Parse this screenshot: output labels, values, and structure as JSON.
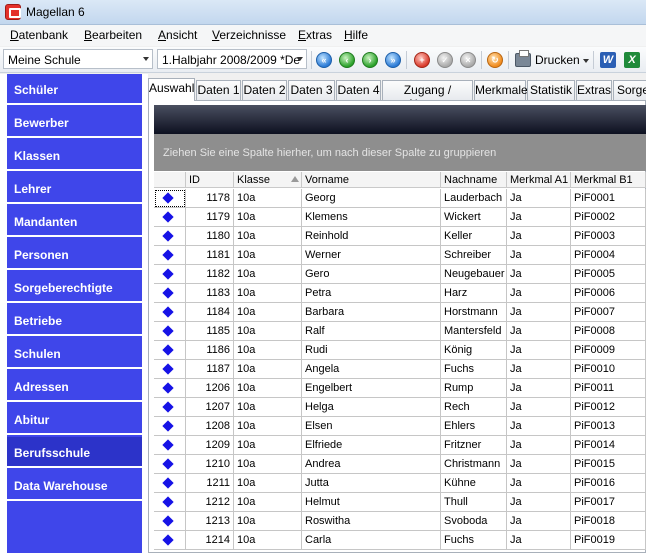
{
  "window": {
    "title": "Magellan 6"
  },
  "menu": [
    {
      "label": "Datenbank",
      "u": "D",
      "rest": "atenbank"
    },
    {
      "label": "Bearbeiten",
      "u": "B",
      "rest": "earbeiten"
    },
    {
      "label": "Ansicht",
      "u": "A",
      "rest": "nsicht"
    },
    {
      "label": "Verzeichnisse",
      "u": "V",
      "rest": "erzeichnisse"
    },
    {
      "label": "Extras",
      "u": "E",
      "rest": "xtras"
    },
    {
      "label": "Hilfe",
      "u": "H",
      "rest": "ilfe"
    }
  ],
  "toolbar": {
    "school_value": "Meine Schule",
    "period_value": "1.Halbjahr 2008/2009 *De",
    "print_label": "Drucken",
    "icons": [
      "first-icon",
      "prev-icon",
      "next-icon",
      "last-icon",
      "add-icon",
      "confirm-icon",
      "cancel-icon",
      "refresh-icon",
      "printer-icon",
      "word-icon",
      "excel-icon"
    ],
    "word_letter": "W",
    "excel_letter": "X"
  },
  "sidebar": {
    "items": [
      {
        "label": "Schüler",
        "active": false
      },
      {
        "label": "Bewerber",
        "active": false
      },
      {
        "label": "Klassen",
        "active": false
      },
      {
        "label": "Lehrer",
        "active": false
      },
      {
        "label": "Mandanten",
        "active": false
      },
      {
        "label": "Personen",
        "active": false
      },
      {
        "label": "Sorgeberechtigte",
        "active": false
      },
      {
        "label": "Betriebe",
        "active": false
      },
      {
        "label": "Schulen",
        "active": false
      },
      {
        "label": "Adressen",
        "active": false
      },
      {
        "label": "Abitur",
        "active": false
      },
      {
        "label": "Berufsschule",
        "active": true
      },
      {
        "label": "Data Warehouse",
        "active": false
      }
    ]
  },
  "tabs": [
    {
      "label": "Auswahl",
      "active": true
    },
    {
      "label": "Daten 1",
      "active": false
    },
    {
      "label": "Daten 2",
      "active": false
    },
    {
      "label": "Daten 3",
      "active": false
    },
    {
      "label": "Daten 4",
      "active": false
    },
    {
      "label": "Zugang / Abgang",
      "active": false
    },
    {
      "label": "Merkmale",
      "active": false
    },
    {
      "label": "Statistik",
      "active": false
    },
    {
      "label": "Extras",
      "active": false
    },
    {
      "label": "Sorge",
      "active": false
    }
  ],
  "grid": {
    "group_hint": "Ziehen Sie eine Spalte hierher, um nach dieser Spalte zu gruppieren",
    "columns": [
      "ID",
      "Klasse",
      "Vorname",
      "Nachname",
      "Merkmal A1",
      "Merkmal B1"
    ],
    "rows": [
      [
        "1178",
        "10a",
        "Georg",
        "Lauderbach",
        "Ja",
        "PiF0001"
      ],
      [
        "1179",
        "10a",
        "Klemens",
        "Wickert",
        "Ja",
        "PiF0002"
      ],
      [
        "1180",
        "10a",
        "Reinhold",
        "Keller",
        "Ja",
        "PiF0003"
      ],
      [
        "1181",
        "10a",
        "Werner",
        "Schreiber",
        "Ja",
        "PiF0004"
      ],
      [
        "1182",
        "10a",
        "Gero",
        "Neugebauer",
        "Ja",
        "PiF0005"
      ],
      [
        "1183",
        "10a",
        "Petra",
        "Harz",
        "Ja",
        "PiF0006"
      ],
      [
        "1184",
        "10a",
        "Barbara",
        "Horstmann",
        "Ja",
        "PiF0007"
      ],
      [
        "1185",
        "10a",
        "Ralf",
        "Mantersfeld",
        "Ja",
        "PiF0008"
      ],
      [
        "1186",
        "10a",
        "Rudi",
        "König",
        "Ja",
        "PiF0009"
      ],
      [
        "1187",
        "10a",
        "Angela",
        "Fuchs",
        "Ja",
        "PiF0010"
      ],
      [
        "1206",
        "10a",
        "Engelbert",
        "Rump",
        "Ja",
        "PiF0011"
      ],
      [
        "1207",
        "10a",
        "Helga",
        "Rech",
        "Ja",
        "PiF0012"
      ],
      [
        "1208",
        "10a",
        "Elsen",
        "Ehlers",
        "Ja",
        "PiF0013"
      ],
      [
        "1209",
        "10a",
        "Elfriede",
        "Fritzner",
        "Ja",
        "PiF0014"
      ],
      [
        "1210",
        "10a",
        "Andrea",
        "Christmann",
        "Ja",
        "PiF0015"
      ],
      [
        "1211",
        "10a",
        "Jutta",
        "Kühne",
        "Ja",
        "PiF0016"
      ],
      [
        "1212",
        "10a",
        "Helmut",
        "Thull",
        "Ja",
        "PiF0017"
      ],
      [
        "1213",
        "10a",
        "Roswitha",
        "Svoboda",
        "Ja",
        "PiF0018"
      ],
      [
        "1214",
        "10a",
        "Carla",
        "Fuchs",
        "Ja",
        "PiF0019"
      ]
    ]
  }
}
